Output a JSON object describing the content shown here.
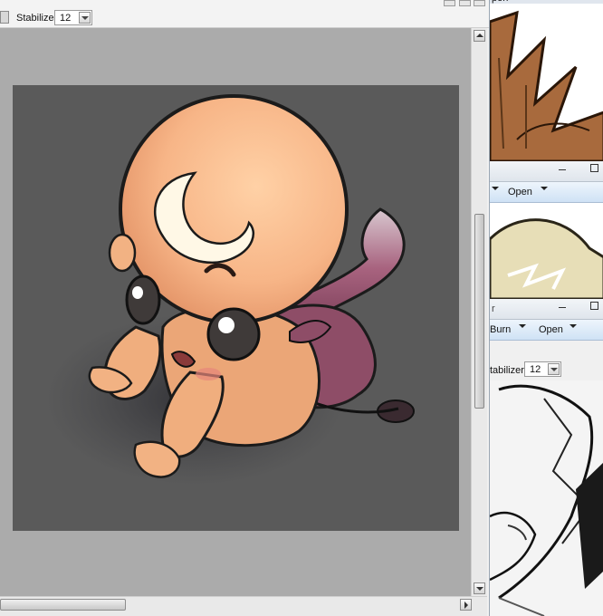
{
  "toolbar": {
    "stabilizer_label": "Stabilizer",
    "stabilizer_value": "12"
  },
  "right_panels": {
    "panel1": {
      "title_partial": "pen"
    },
    "panel2": {
      "menu_open": "Open"
    },
    "panel3": {
      "menu_burn": "Burn",
      "menu_open": "Open",
      "stabilizer_label": "tabilizer",
      "stabilizer_value": "12"
    }
  },
  "colors": {
    "canvas_bg": "#5a5a5a",
    "viewport_bg": "#ababab",
    "skin": "#f5b98a",
    "tail": "#8e4d67",
    "hair": "#fff8e6"
  },
  "icons": [
    "tool-icon",
    "dropdown-arrow-icon",
    "scroll-up-icon",
    "scroll-down-icon",
    "scroll-right-icon",
    "minimize-icon",
    "maximize-icon"
  ]
}
